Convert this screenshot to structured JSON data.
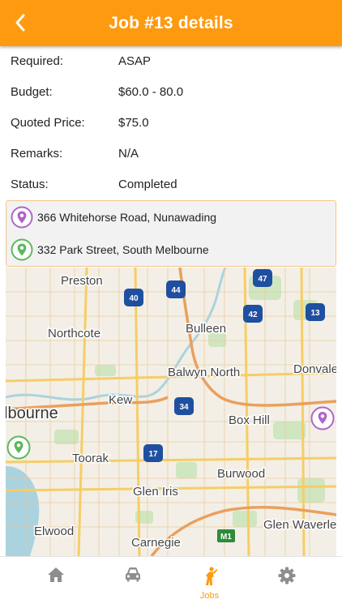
{
  "header": {
    "title": "Job #13 details",
    "back_icon": "chevron-left-icon",
    "color": "#fd9a10"
  },
  "details": [
    {
      "label": "Required:",
      "value": "ASAP"
    },
    {
      "label": "Budget:",
      "value": "$60.0 - 80.0"
    },
    {
      "label": "Quoted Price:",
      "value": "$75.0"
    },
    {
      "label": "Remarks:",
      "value": "N/A"
    },
    {
      "label": "Status:",
      "value": "Completed"
    }
  ],
  "addresses": {
    "pickup": {
      "text": "366 Whitehorse Road, Nunawading",
      "icon": "pin-icon",
      "color": "#b065c9"
    },
    "dropoff": {
      "text": "332 Park Street, South Melbourne",
      "icon": "pin-icon",
      "color": "#5cb85c"
    }
  },
  "map": {
    "places": {
      "preston": "Preston",
      "northcote": "Northcote",
      "bulleen": "Bulleen",
      "balwyn_north": "Balwyn North",
      "donvale": "Donvale",
      "kew": "Kew",
      "melbourne": "lbourne",
      "box_hill": "Box Hill",
      "toorak": "Toorak",
      "burwood": "Burwood",
      "glen_iris": "Glen Iris",
      "glen_waverley": "Glen Waverle",
      "elwood": "Elwood",
      "carnegie": "Carnegie"
    },
    "shields": {
      "s40": "40",
      "s44": "44",
      "s47": "47",
      "s42": "42",
      "s13": "13",
      "s34": "34",
      "s17": "17",
      "m1": "M1"
    }
  },
  "tabbar": {
    "tabs": [
      {
        "icon": "home-icon",
        "label": ""
      },
      {
        "icon": "car-icon",
        "label": ""
      },
      {
        "icon": "jobs-icon",
        "label": "Jobs",
        "active": true
      },
      {
        "icon": "gear-icon",
        "label": ""
      }
    ],
    "active_color": "#fd9a10",
    "inactive_color": "#8e8e8e"
  }
}
